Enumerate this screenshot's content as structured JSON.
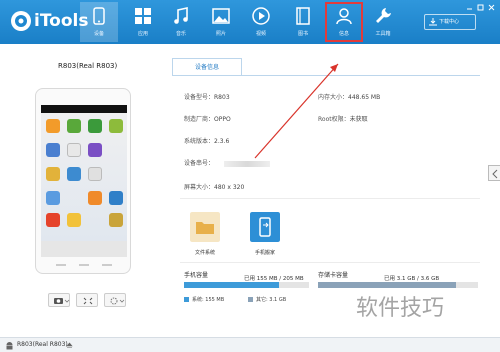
{
  "app": {
    "name": "iTools",
    "download_label": "下载中心"
  },
  "nav": {
    "items": [
      {
        "label": "设备",
        "icon": "phone-icon"
      },
      {
        "label": "应用",
        "icon": "apps-icon"
      },
      {
        "label": "音乐",
        "icon": "music-icon"
      },
      {
        "label": "照片",
        "icon": "photo-icon"
      },
      {
        "label": "视频",
        "icon": "video-icon"
      },
      {
        "label": "图书",
        "icon": "book-icon"
      },
      {
        "label": "信息",
        "icon": "person-icon"
      },
      {
        "label": "工具箱",
        "icon": "wrench-icon"
      }
    ]
  },
  "device": {
    "title": "R803(Real R803)"
  },
  "info": {
    "tab_label": "设备信息",
    "model_label": "设备型号：",
    "model_value": "R803",
    "memory_label": "内存大小：",
    "memory_value": "448.65 MB",
    "vendor_label": "制造厂商：",
    "vendor_value": "OPPO",
    "root_label": "Root权限：",
    "root_value": "未获取",
    "version_label": "系统版本：",
    "version_value": "2.3.6",
    "serial_label": "设备串号：",
    "resolution_label": "屏幕大小：",
    "resolution_value": "480 x 320"
  },
  "functions": {
    "file_system": "文件系统",
    "phone_move": "手机搬家"
  },
  "storage": {
    "phone_label": "手机容量",
    "phone_used_text": "已用 155 MB / 205 MB",
    "phone_used_fraction": 0.756,
    "sd_label": "存储卡容量",
    "sd_used_text": "已用 3.1 GB / 3.6 GB",
    "sd_used_fraction": 0.86,
    "system_legend": "系统: 155 MB",
    "other_legend": "其它: 3.1 GB"
  },
  "statusbar": {
    "device_name": "R803(Real R803)"
  },
  "watermark": "软件技巧",
  "colors": {
    "topbar": "#1f88d0",
    "highlight": "#e23b3b",
    "system": "#3d9bd9",
    "other": "#8aa2b8"
  }
}
